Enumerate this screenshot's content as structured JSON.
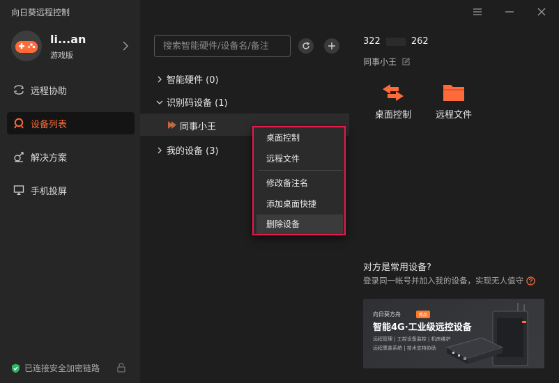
{
  "app": {
    "title": "向日葵远程控制"
  },
  "user": {
    "name": "li...an",
    "edition": "游戏版"
  },
  "nav": {
    "items": [
      {
        "label": "远程协助",
        "icon": "remote-assist-icon",
        "active": false
      },
      {
        "label": "设备列表",
        "icon": "device-list-icon",
        "active": true
      },
      {
        "label": "解决方案",
        "icon": "solutions-icon",
        "active": false
      },
      {
        "label": "手机投屏",
        "icon": "screen-cast-icon",
        "active": false
      }
    ]
  },
  "status": {
    "secure_text": "已连接安全加密链路"
  },
  "search": {
    "placeholder": "搜索智能硬件/设备名/备注"
  },
  "tree": {
    "groups": [
      {
        "label": "智能硬件 (0)",
        "expanded": false
      },
      {
        "label": "识别码设备 (1)",
        "expanded": true
      },
      {
        "label": "我的设备 (3)",
        "expanded": false
      }
    ],
    "device": {
      "label": "同事小王"
    }
  },
  "context_menu": {
    "items": [
      {
        "label": "桌面控制"
      },
      {
        "label": "远程文件"
      },
      {
        "label": "修改备注名"
      },
      {
        "label": "添加桌面快捷"
      },
      {
        "label": "删除设备"
      }
    ]
  },
  "detail": {
    "id_prefix": "322",
    "id_suffix": "262",
    "remark": "同事小王",
    "actions": [
      {
        "label": "桌面控制",
        "icon": "desktop-control-icon"
      },
      {
        "label": "远程文件",
        "icon": "remote-file-icon"
      }
    ],
    "prompt_title": "对方是常用设备?",
    "prompt_desc": "登录同一帐号并加入我的设备，实现无人值守"
  },
  "banner": {
    "brand": "向日葵方舟",
    "tag": "新品",
    "title": "智能4G·工业级远控设备",
    "line1": "远程管理 | 工控设备监控 | 机房维护",
    "line2": "远程重装系统 | 技术支持协助"
  },
  "colors": {
    "accent": "#ff6a3a",
    "highlight_border": "#e8194a",
    "sidebar_bg": "#262626",
    "main_bg": "#1e1e1e"
  }
}
